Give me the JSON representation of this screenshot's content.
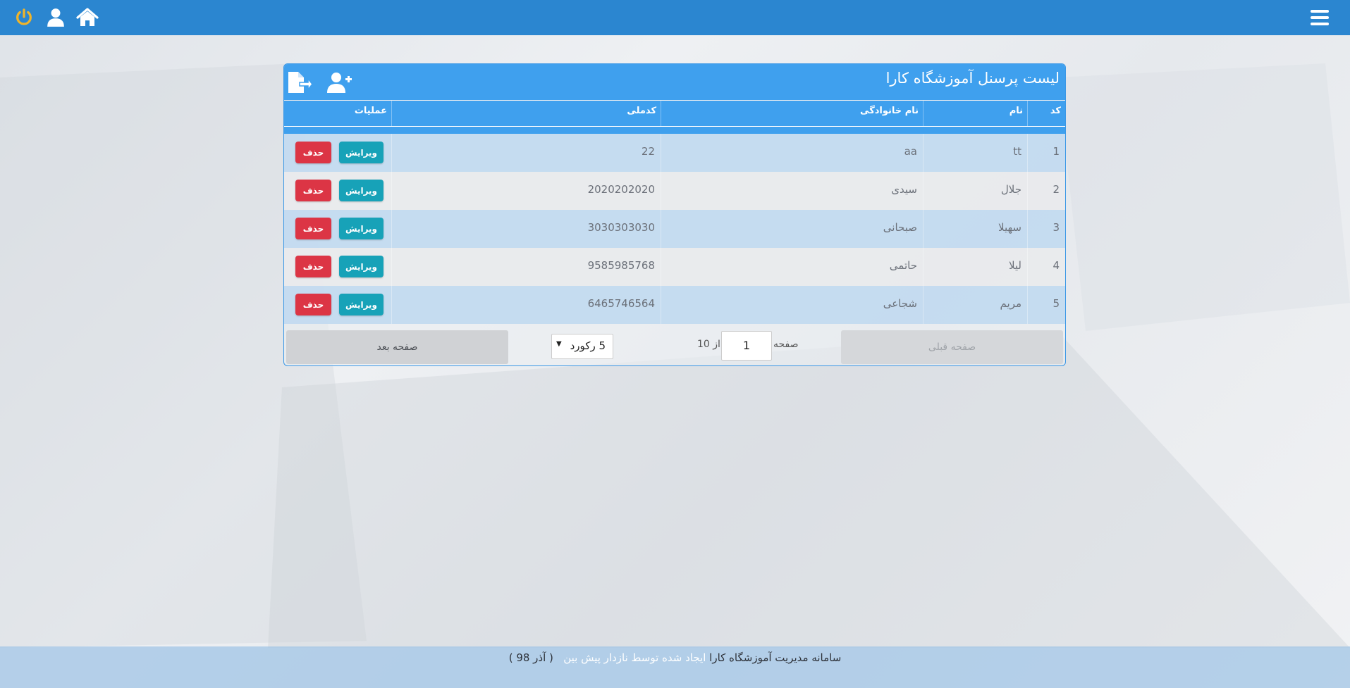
{
  "topbar": {
    "icons": [
      "power-icon",
      "user-icon",
      "home-icon",
      "menu-icon"
    ],
    "color": "#2b86d0",
    "power_color": "#f0b429"
  },
  "panel": {
    "title": "لیست پرسنل آموزشگاه کارا",
    "header_icons": [
      "add-user-icon",
      "export-file-icon"
    ]
  },
  "table": {
    "headers": {
      "code": "کد",
      "first_name": "نام",
      "last_name": "نام خانوادگی",
      "national_id": "کدملی",
      "operations": "عملیات"
    },
    "edit_label": "ویرایش",
    "delete_label": "حذف",
    "rows": [
      {
        "code": "1",
        "first_name": "tt",
        "last_name": "aa",
        "national_id": "22"
      },
      {
        "code": "2",
        "first_name": "جلال",
        "last_name": "سیدی",
        "national_id": "2020202020"
      },
      {
        "code": "3",
        "first_name": "سهیلا",
        "last_name": "صبحانی",
        "national_id": "3030303030"
      },
      {
        "code": "4",
        "first_name": "لیلا",
        "last_name": "حاتمی",
        "national_id": "9585985768"
      },
      {
        "code": "5",
        "first_name": "مریم",
        "last_name": "شجاعی",
        "national_id": "6465746564"
      }
    ]
  },
  "pager": {
    "prev_label": "صفحه قبلی",
    "page_label": "صفحه",
    "current_page": "1",
    "of_label": "از 10",
    "page_size": "5 رکورد",
    "next_label": "صفحه بعد"
  },
  "footer": {
    "text_main": "سامانه مدیریت آموزشگاه کارا",
    "text_accent": "ایجاد شده توسط نازدار پیش بین",
    "text_date": "( آذر 98 )"
  },
  "colors": {
    "accent_blue": "#3fa0ee",
    "edit": "#17a2b8",
    "delete": "#dc3545"
  }
}
